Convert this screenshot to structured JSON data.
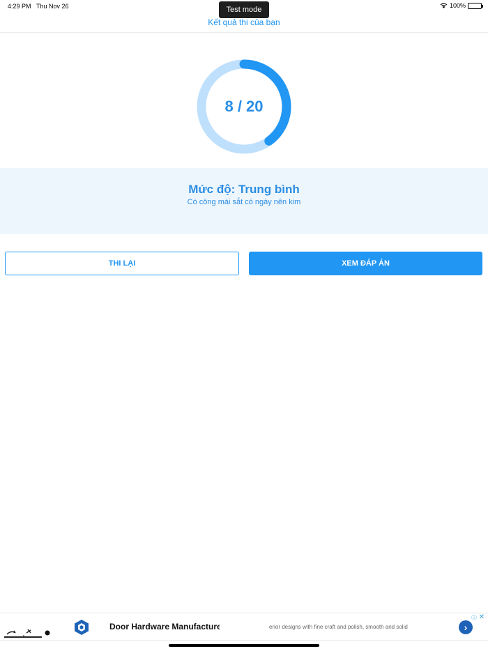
{
  "status_bar": {
    "time": "4:29 PM",
    "date": "Thu Nov 26",
    "battery": "100%",
    "wifi_icon": "wifi-icon",
    "battery_icon": "battery-icon"
  },
  "nav": {
    "title": "Kết quả thi của bạn"
  },
  "result": {
    "score_text": "8 / 20",
    "correct": 8,
    "total": 20,
    "track_color": "#bfe0fc",
    "progress_color": "#2196f3"
  },
  "level": {
    "title": "Mức độ: Trung bình",
    "subtitle": "Có công mài sắt có ngày nên kim"
  },
  "actions": {
    "retry_label": "THI LẠI",
    "view_answers_label": "XEM ĐÁP ÁN"
  },
  "ad": {
    "title": "Door Hardware Manufacturer",
    "description": "erior designs with fine craft and polish, smooth and solid",
    "test_mode_label": "Test mode",
    "ad_choices_icon": "ad-choices-icon",
    "close_icon": "close-icon",
    "arrow_icon": "chevron-right-icon"
  },
  "colors": {
    "accent": "#2196f3",
    "panel_bg": "#eef6fd"
  }
}
